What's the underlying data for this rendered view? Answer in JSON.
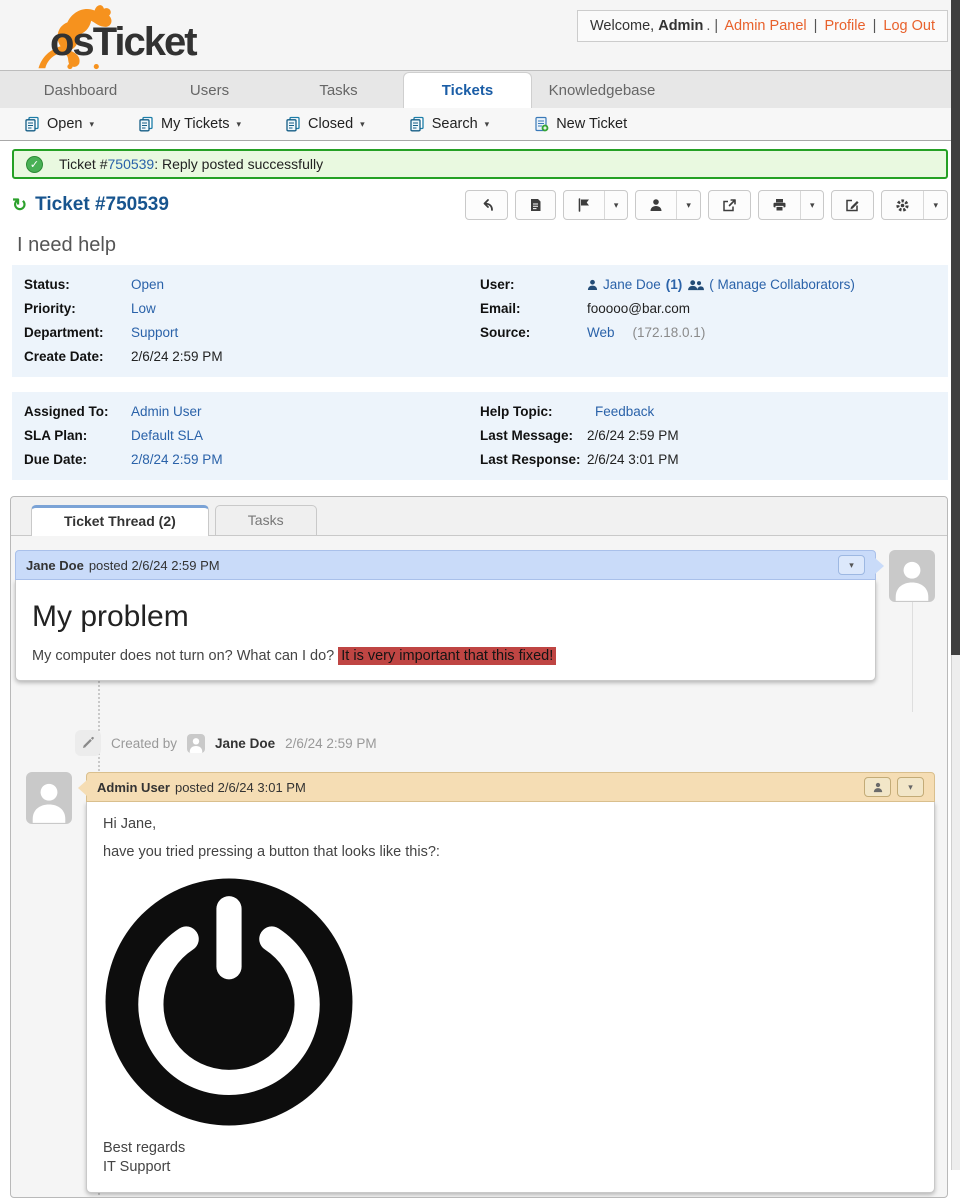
{
  "logo": {
    "os": "os",
    "ticket": "Ticket"
  },
  "topbar": {
    "welcome": "Welcome,",
    "username": "Admin",
    "after_user": ". |",
    "pipe": "|",
    "links": [
      {
        "label": "Admin Panel"
      },
      {
        "label": "Profile"
      },
      {
        "label": "Log Out"
      }
    ]
  },
  "nav": {
    "tabs": [
      {
        "label": "Dashboard"
      },
      {
        "label": "Users"
      },
      {
        "label": "Tasks"
      },
      {
        "label": "Tickets"
      },
      {
        "label": "Knowledgebase"
      }
    ]
  },
  "subnav": {
    "items": [
      {
        "label": "Open"
      },
      {
        "label": "My Tickets"
      },
      {
        "label": "Closed"
      },
      {
        "label": "Search"
      },
      {
        "label": "New Ticket"
      }
    ]
  },
  "ui": {
    "caret": "▾",
    "check": "✓",
    "refresh": "↻"
  },
  "alert": {
    "prefix": "Ticket #",
    "number": "750539",
    "suffix": ": Reply posted successfully"
  },
  "ticket": {
    "title": "Ticket #750539",
    "subject": "I need help",
    "info": {
      "status_label": "Status:",
      "status": "Open",
      "priority_label": "Priority:",
      "priority": "Low",
      "department_label": "Department:",
      "department": "Support",
      "create_date_label": "Create Date:",
      "create_date": "2/6/24 2:59 PM",
      "user_label": "User:",
      "user_name": "Jane Doe",
      "user_count": "(1)",
      "manage_collab": "( Manage Collaborators)",
      "email_label": "Email:",
      "email": "fooooo@bar.com",
      "source_label": "Source:",
      "source": "Web",
      "source_ip": "(172.18.0.1)",
      "assigned_label": "Assigned To:",
      "assigned": "Admin User",
      "sla_label": "SLA Plan:",
      "sla": "Default SLA",
      "due_label": "Due Date:",
      "due": "2/8/24 2:59 PM",
      "topic_label": "Help Topic:",
      "topic": "Feedback",
      "last_msg_label": "Last Message:",
      "last_msg": "2/6/24 2:59 PM",
      "last_resp_label": "Last Response:",
      "last_resp": "2/6/24 3:01 PM"
    },
    "tabs": {
      "thread": "Ticket Thread (2)",
      "tasks": "Tasks"
    }
  },
  "thread": {
    "jane": {
      "author": "Jane Doe",
      "posted": "posted 2/6/24 2:59 PM",
      "title": "My problem",
      "body": "My computer does not turn on? What can I do?",
      "highlight": "It is very important that this fixed!"
    },
    "event": {
      "action": "Created by",
      "author": "Jane Doe",
      "date": "2/6/24 2:59 PM"
    },
    "admin": {
      "author": "Admin User",
      "posted": "posted 2/6/24 3:01 PM",
      "line1": "Hi Jane,",
      "line2": "have you tried pressing a button that looks like this?:",
      "sig1": "Best regards",
      "sig2": "IT Support"
    }
  },
  "colors": {
    "accent_orange": "#e8612c",
    "link_blue": "#2a62a9",
    "title_blue": "#17548e",
    "success_green": "#25a125",
    "jane_header": "#c9dbf9",
    "admin_header": "#f5ddb4",
    "highlight_red": "#bf4543"
  }
}
